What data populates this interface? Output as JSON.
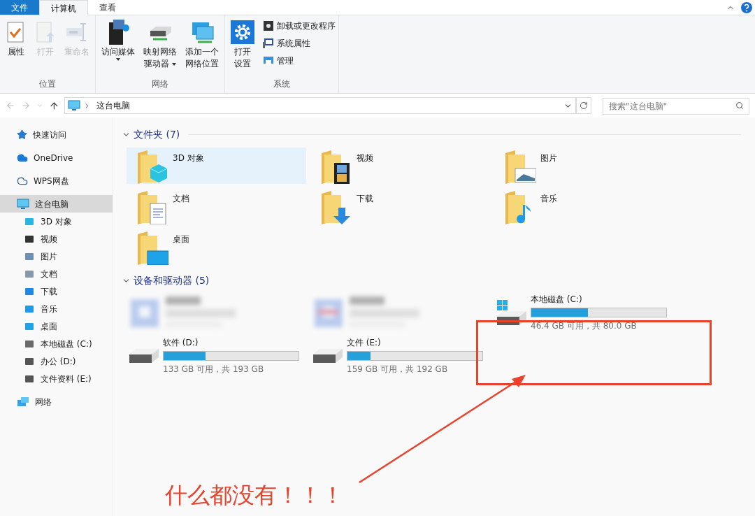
{
  "ribbon": {
    "tabs": [
      {
        "label": "文件",
        "kind": "file",
        "selected": false
      },
      {
        "label": "计算机",
        "kind": "tab",
        "selected": true
      },
      {
        "label": "查看",
        "kind": "tab",
        "selected": false
      }
    ],
    "groups": [
      {
        "label": "位置",
        "buttons": [
          {
            "lines": [
              "属性"
            ],
            "kind": "large",
            "disabled": false,
            "dropdown": false
          },
          {
            "lines": [
              "打开"
            ],
            "kind": "large",
            "disabled": true,
            "dropdown": false
          },
          {
            "lines": [
              "重命名"
            ],
            "kind": "large",
            "disabled": true,
            "dropdown": false
          }
        ]
      },
      {
        "label": "网络",
        "buttons": [
          {
            "lines": [
              "访问媒体"
            ],
            "kind": "large",
            "disabled": false,
            "dropdown": true
          },
          {
            "lines": [
              "映射网络",
              "驱动器"
            ],
            "kind": "large",
            "disabled": false,
            "dropdown": true
          },
          {
            "lines": [
              "添加一个",
              "网络位置"
            ],
            "kind": "large",
            "disabled": false,
            "dropdown": false
          }
        ]
      },
      {
        "label": "系统",
        "buttons": [
          {
            "lines": [
              "打开",
              "设置"
            ],
            "kind": "large",
            "disabled": false,
            "dropdown": false
          },
          {
            "lines": [
              "卸载或更改程序"
            ],
            "kind": "small",
            "disabled": false
          },
          {
            "lines": [
              "系统属性"
            ],
            "kind": "small",
            "disabled": false
          },
          {
            "lines": [
              "管理"
            ],
            "kind": "small",
            "disabled": false
          }
        ]
      }
    ]
  },
  "address": {
    "path": "这台电脑",
    "search_placeholder": "搜索\"这台电脑\""
  },
  "sidebar": {
    "items": [
      {
        "label": "快速访问",
        "selected": false
      },
      {
        "label": "OneDrive",
        "selected": false
      },
      {
        "label": "WPS网盘",
        "selected": false
      },
      {
        "label": "这台电脑",
        "selected": true,
        "children": [
          {
            "label": "3D 对象",
            "selected": false
          },
          {
            "label": "视频",
            "selected": false
          },
          {
            "label": "图片",
            "selected": false
          },
          {
            "label": "文档",
            "selected": false
          },
          {
            "label": "下载",
            "selected": false
          },
          {
            "label": "音乐",
            "selected": false
          },
          {
            "label": "桌面",
            "selected": false
          },
          {
            "label": "本地磁盘 (C:)",
            "selected": false
          },
          {
            "label": "办公 (D:)",
            "selected": false
          },
          {
            "label": "文件资料 (E:)",
            "selected": false
          }
        ]
      },
      {
        "label": "网络",
        "selected": false
      }
    ]
  },
  "folders": {
    "title": "文件夹 (7)",
    "items": [
      {
        "name": "3D 对象",
        "selected": true
      },
      {
        "name": "视频",
        "selected": false
      },
      {
        "name": "图片",
        "selected": false
      },
      {
        "name": "文档",
        "selected": false
      },
      {
        "name": "下载",
        "selected": false
      },
      {
        "name": "音乐",
        "selected": false
      },
      {
        "name": "桌面",
        "selected": false
      }
    ]
  },
  "devices": {
    "title": "设备和驱动器 (5)",
    "items": [
      {
        "kind": "picture"
      },
      {
        "kind": "picture"
      },
      {
        "kind": "drive",
        "system": true,
        "name": "本地磁盘 (C:)",
        "level": 0.42,
        "reading": "46.4 GB 可用，共 80.0 GB"
      },
      {
        "kind": "drive",
        "system": false,
        "name": "软件 (D:)",
        "level": 0.31,
        "reading": "133 GB 可用，共 193 GB"
      },
      {
        "kind": "drive",
        "system": false,
        "name": "文件 (E:)",
        "level": 0.17,
        "reading": "159 GB 可用，共 192 GB"
      }
    ]
  },
  "annotation": {
    "text": "什么都没有！！！"
  }
}
